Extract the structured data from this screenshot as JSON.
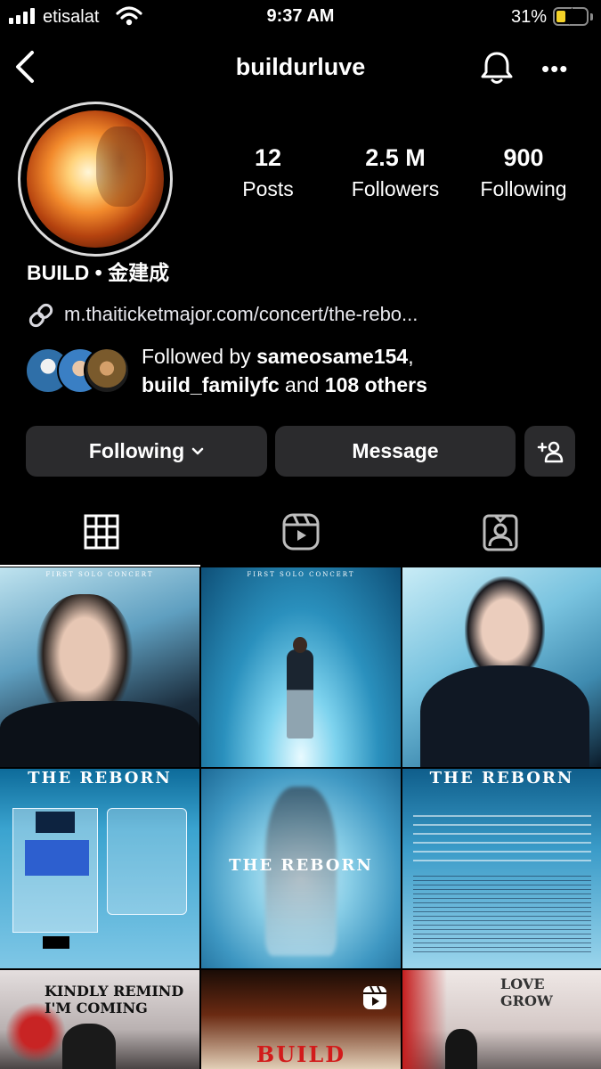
{
  "status_bar": {
    "carrier": "etisalat",
    "time": "9:37 AM",
    "battery_percent": "31%",
    "battery_level": 0.31,
    "icons": [
      "signal-icon",
      "wifi-icon",
      "battery-charging-icon"
    ]
  },
  "header": {
    "username": "buildurluve",
    "icons": [
      "back-icon",
      "bell-icon",
      "more-icon"
    ],
    "more_glyph": "•••"
  },
  "profile": {
    "stats": [
      {
        "value": "12",
        "label": "Posts"
      },
      {
        "value": "2.5 M",
        "label": "Followers"
      },
      {
        "value": "900",
        "label": "Following"
      }
    ],
    "full_name": "BUILD • 金建成",
    "link": "m.thaiticketmajor.com/concert/the-rebo...",
    "followed_by": {
      "prefix": "Followed by ",
      "user1": "sameosame154",
      "sep": ",",
      "user2": "build_familyfc",
      "mid": " and ",
      "others": "108 others"
    }
  },
  "actions": {
    "following_label": "Following",
    "message_label": "Message"
  },
  "tabs": [
    "grid-tab",
    "reels-tab",
    "tagged-tab"
  ],
  "posts": [
    {
      "text": "FIRST SOLO CONCERT"
    },
    {
      "text": "FIRST SOLO CONCERT"
    },
    {
      "text": ""
    },
    {
      "text": "THE REBORN"
    },
    {
      "text": "THE REBORN"
    },
    {
      "text": "THE REBORN"
    },
    {
      "text": "KINDLY REMIND I'M COMING"
    },
    {
      "text": "BUILD"
    },
    {
      "text": "LOVE GROW"
    }
  ],
  "colors": {
    "background": "#000000",
    "button": "#2b2b2d",
    "battery": "#f5d328"
  }
}
